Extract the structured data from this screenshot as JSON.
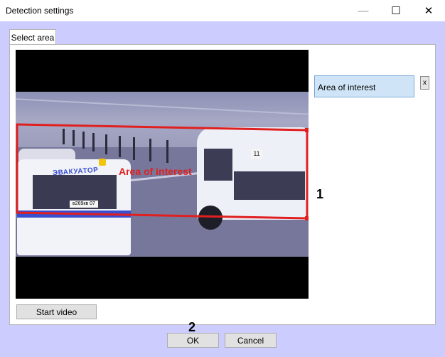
{
  "window": {
    "title": "Detection settings",
    "controls": {
      "minimize": "—",
      "maximize": "☐",
      "close": "✕"
    }
  },
  "tabs": [
    {
      "label": "Select area",
      "active": true
    }
  ],
  "video": {
    "area_label": "Area of interest",
    "truck_text": "ЭВАКУАТОР",
    "truck_plate": "в269кв 07",
    "van_number": "11",
    "area_color": "#e02020"
  },
  "zones": {
    "items": [
      {
        "label": "Area of interest",
        "selected": true
      }
    ],
    "delete_label": "x"
  },
  "buttons": {
    "start_video": "Start video",
    "ok": "OK",
    "cancel": "Cancel"
  },
  "callouts": {
    "one": "1",
    "two": "2"
  },
  "colors": {
    "background": "#ccccff",
    "selection": "#cfe5f7",
    "area_outline": "#e02020"
  }
}
